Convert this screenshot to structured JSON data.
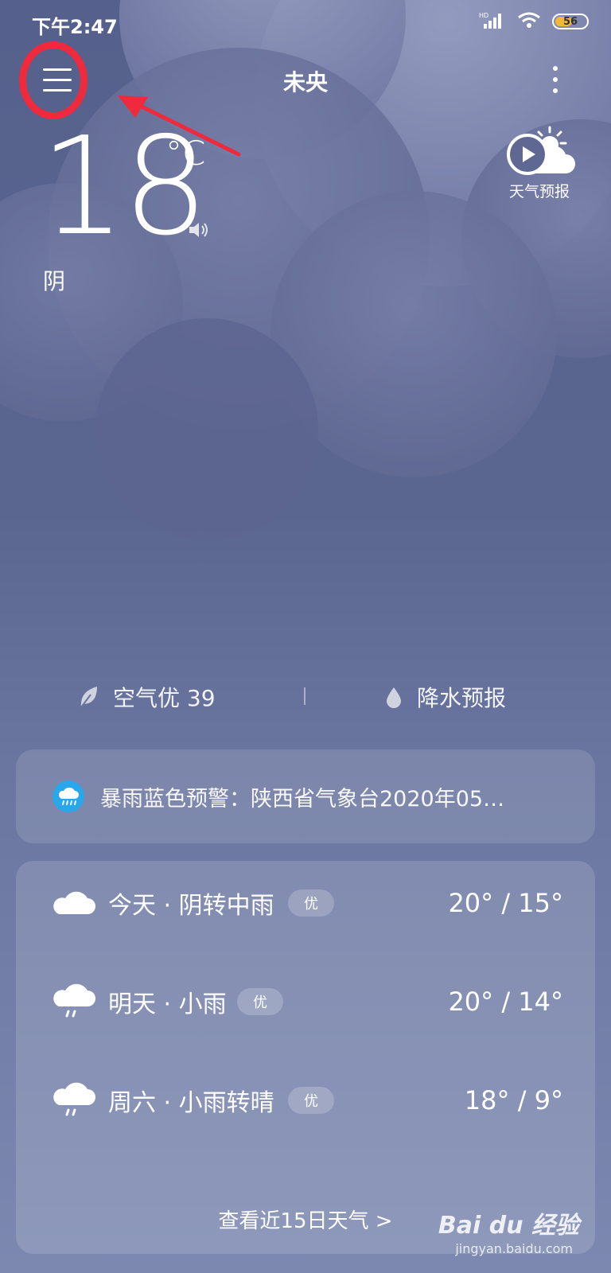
{
  "status_bar": {
    "time": "下午2:47",
    "network": "HD",
    "battery": "56",
    "battery_level": 0.56
  },
  "header": {
    "city": "未央"
  },
  "current": {
    "temperature": "18",
    "unit": "°C",
    "condition": "阴"
  },
  "forecast_video": {
    "label": "天气预报"
  },
  "air_quality": {
    "label": "空气优 39"
  },
  "precipitation": {
    "label": "降水预报"
  },
  "alert": {
    "text": "暴雨蓝色预警：陕西省气象台2020年05…"
  },
  "daily": [
    {
      "day": "今天 · 阴转中雨",
      "aqi": "优",
      "temps": "20° / 15°",
      "icon": "cloud-icon"
    },
    {
      "day": "明天 · 小雨",
      "aqi": "优",
      "temps": "20° / 14°",
      "icon": "light-rain-icon"
    },
    {
      "day": "周六 · 小雨转晴",
      "aqi": "优",
      "temps": "18° / 9°",
      "icon": "light-rain-icon"
    }
  ],
  "more_days": "查看近15日天气  >",
  "watermark": {
    "main": "Bai du 经验",
    "sub": "jingyan.baidu.com"
  },
  "colors": {
    "highlight": "#ee2a3c",
    "alert_icon": "#2aa7ea",
    "battery": "#f3b83a"
  }
}
